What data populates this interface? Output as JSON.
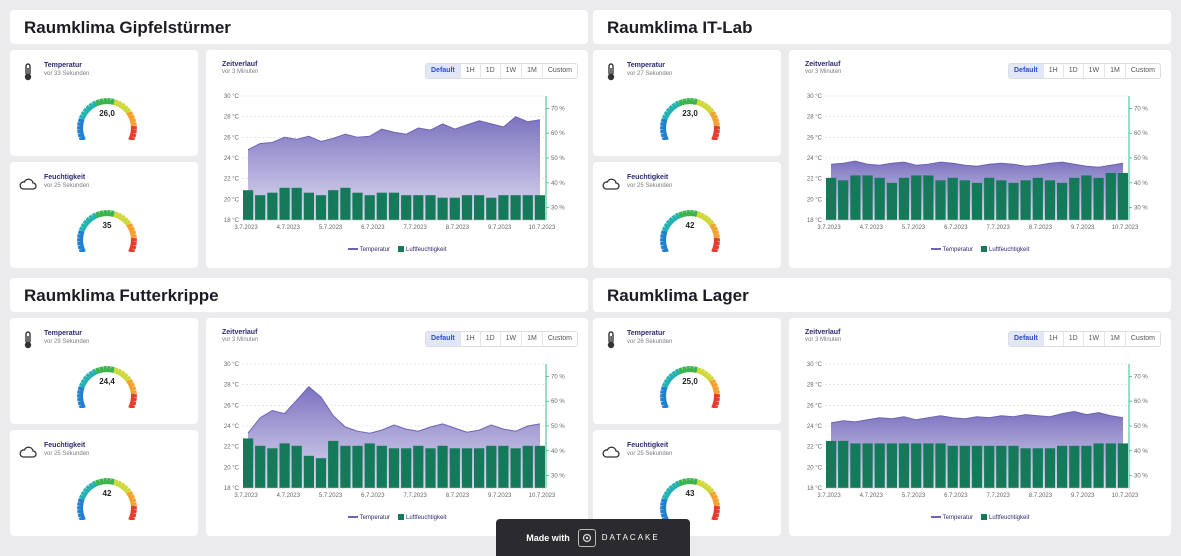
{
  "range_buttons": [
    "Default",
    "1H",
    "1D",
    "1W",
    "1M",
    "Custom"
  ],
  "chart_title": "Zeitverlauf",
  "legend": {
    "temp": "Temperatur",
    "hum": "Luftfeuchtigkeit"
  },
  "kpi_temp_title": "Temperatur",
  "kpi_hum_title": "Feuchtigkeit",
  "colors": {
    "temp_area": "#8a82c4",
    "temp_line": "#6e63b3",
    "hum_bar": "#157a5a",
    "hum_axis": "#2fbf8f"
  },
  "footer": {
    "made_with": "Made with",
    "brand": "DATACAKE",
    "logo_icon": "datacake-logo-icon"
  },
  "panels": [
    {
      "title": "Raumklima Gipfelstürmer",
      "temp": {
        "updated": "vor 33 Sekunden",
        "value": "26,0",
        "icon": "thermometer-icon"
      },
      "hum": {
        "updated": "vor 25 Sekunden",
        "value": "35",
        "icon": "cloud-icon"
      },
      "chart_updated": "vor 3 Minuten"
    },
    {
      "title": "Raumklima IT-Lab",
      "temp": {
        "updated": "vor 27 Sekunden",
        "value": "23,0",
        "icon": "thermometer-icon"
      },
      "hum": {
        "updated": "vor 25 Sekunden",
        "value": "42",
        "icon": "cloud-icon"
      },
      "chart_updated": "vor 3 Minuten"
    },
    {
      "title": "Raumklima Futterkrippe",
      "temp": {
        "updated": "vor 29 Sekunden",
        "value": "24,4",
        "icon": "thermometer-icon"
      },
      "hum": {
        "updated": "vor 25 Sekunden",
        "value": "42",
        "icon": "cloud-icon"
      },
      "chart_updated": "vor 3 Minuten"
    },
    {
      "title": "Raumklima Lager",
      "temp": {
        "updated": "vor 26 Sekunden",
        "value": "25,0",
        "icon": "thermometer-icon"
      },
      "hum": {
        "updated": "vor 25 Sekunden",
        "value": "43",
        "icon": "cloud-icon"
      },
      "chart_updated": "vor 3 Minuten"
    }
  ],
  "chart_data": [
    {
      "type": "area",
      "x": [
        "3.7.2023",
        "4.7.2023",
        "5.7.2023",
        "6.7.2023",
        "7.7.2023",
        "8.7.2023",
        "9.7.2023",
        "10.7.2023"
      ],
      "y_ticks": [
        "18 °C",
        "20 °C",
        "22 °C",
        "24 °C",
        "26 °C",
        "28 °C",
        "30 °C"
      ],
      "y2_ticks": [
        "30 %",
        "40 %",
        "50 %",
        "60 %",
        "70 %"
      ],
      "ylim": [
        18,
        30
      ],
      "y2lim": [
        25,
        75
      ],
      "series": [
        {
          "name": "Temperatur",
          "values": [
            24.8,
            25.4,
            25.5,
            26.0,
            25.8,
            26.1,
            25.6,
            25.9,
            26.3,
            26.0,
            26.1,
            26.8,
            26.5,
            26.3,
            26.9,
            26.7,
            27.3,
            26.8,
            27.2,
            27.6,
            27.3,
            27.0,
            28.0,
            27.5,
            27.7
          ]
        },
        {
          "name": "Luftfeuchtigkeit",
          "values": [
            37,
            35,
            36,
            38,
            38,
            36,
            35,
            37,
            38,
            36,
            35,
            36,
            36,
            35,
            35,
            35,
            34,
            34,
            35,
            35,
            34,
            35,
            35,
            35,
            35
          ]
        }
      ]
    },
    {
      "type": "area",
      "x": [
        "3.7.2023",
        "4.7.2023",
        "5.7.2023",
        "6.7.2023",
        "7.7.2023",
        "8.7.2023",
        "9.7.2023",
        "10.7.2023"
      ],
      "y_ticks": [
        "18 °C",
        "20 °C",
        "22 °C",
        "24 °C",
        "26 °C",
        "28 °C",
        "30 °C"
      ],
      "y2_ticks": [
        "30 %",
        "40 %",
        "50 %",
        "60 %",
        "70 %"
      ],
      "ylim": [
        18,
        30
      ],
      "y2lim": [
        25,
        75
      ],
      "series": [
        {
          "name": "Temperatur",
          "values": [
            23.4,
            23.5,
            23.7,
            23.4,
            23.3,
            23.5,
            23.6,
            23.3,
            23.4,
            23.6,
            23.5,
            23.3,
            23.2,
            23.4,
            23.5,
            23.4,
            23.2,
            23.3,
            23.5,
            23.6,
            23.4,
            23.2,
            23.1,
            23.3,
            23.5
          ]
        },
        {
          "name": "Luftfeuchtigkeit",
          "values": [
            42,
            41,
            43,
            43,
            42,
            40,
            42,
            43,
            43,
            41,
            42,
            41,
            40,
            42,
            41,
            40,
            41,
            42,
            41,
            40,
            42,
            43,
            42,
            44,
            44
          ]
        }
      ]
    },
    {
      "type": "area",
      "x": [
        "3.7.2023",
        "4.7.2023",
        "5.7.2023",
        "6.7.2023",
        "7.7.2023",
        "8.7.2023",
        "9.7.2023",
        "10.7.2023"
      ],
      "y_ticks": [
        "18 °C",
        "20 °C",
        "22 °C",
        "24 °C",
        "26 °C",
        "28 °C",
        "30 °C"
      ],
      "y2_ticks": [
        "30 %",
        "40 %",
        "50 %",
        "60 %",
        "70 %"
      ],
      "ylim": [
        18,
        30
      ],
      "y2lim": [
        25,
        75
      ],
      "series": [
        {
          "name": "Temperatur",
          "values": [
            23.3,
            24.8,
            25.5,
            25.2,
            26.5,
            27.8,
            26.8,
            25.0,
            23.9,
            23.5,
            23.3,
            23.6,
            24.1,
            23.7,
            23.5,
            23.9,
            24.2,
            23.8,
            23.4,
            23.6,
            24.1,
            23.7,
            23.5,
            24.0,
            24.2
          ]
        },
        {
          "name": "Luftfeuchtigkeit",
          "values": [
            45,
            42,
            41,
            43,
            42,
            38,
            37,
            44,
            42,
            42,
            43,
            42,
            41,
            41,
            42,
            41,
            42,
            41,
            41,
            41,
            42,
            42,
            41,
            42,
            42
          ]
        }
      ]
    },
    {
      "type": "area",
      "x": [
        "3.7.2023",
        "4.7.2023",
        "5.7.2023",
        "6.7.2023",
        "7.7.2023",
        "8.7.2023",
        "9.7.2023",
        "10.7.2023"
      ],
      "y_ticks": [
        "18 °C",
        "20 °C",
        "22 °C",
        "24 °C",
        "26 °C",
        "28 °C",
        "30 °C"
      ],
      "y2_ticks": [
        "30 %",
        "40 %",
        "50 %",
        "60 %",
        "70 %"
      ],
      "ylim": [
        18,
        30
      ],
      "y2lim": [
        25,
        75
      ],
      "series": [
        {
          "name": "Temperatur",
          "values": [
            24.3,
            24.5,
            24.4,
            24.6,
            24.8,
            24.7,
            24.9,
            24.6,
            24.8,
            25.0,
            24.8,
            24.7,
            24.9,
            24.8,
            25.0,
            24.9,
            25.1,
            25.0,
            24.9,
            25.2,
            25.4,
            25.1,
            25.3,
            25.0,
            24.8
          ]
        },
        {
          "name": "Luftfeuchtigkeit",
          "values": [
            44,
            44,
            43,
            43,
            43,
            43,
            43,
            43,
            43,
            43,
            42,
            42,
            42,
            42,
            42,
            42,
            41,
            41,
            41,
            42,
            42,
            42,
            43,
            43,
            43
          ]
        }
      ]
    }
  ]
}
